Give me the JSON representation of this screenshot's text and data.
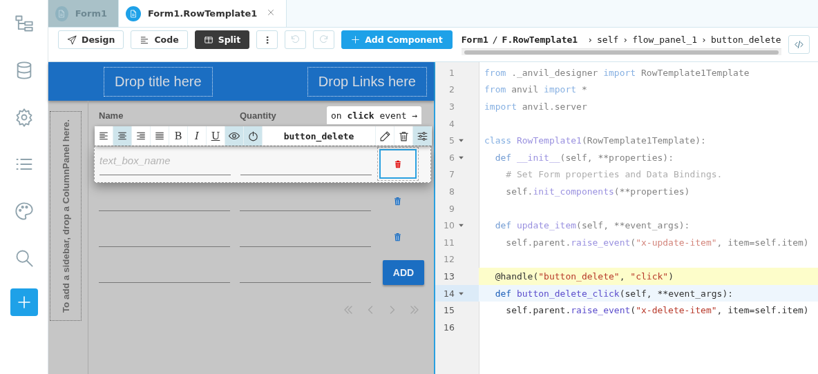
{
  "tabs": [
    {
      "label": "Form1",
      "selected": false,
      "closable": false
    },
    {
      "label": "Form1.RowTemplate1",
      "selected": true,
      "closable": true
    }
  ],
  "toolbar": {
    "modes": [
      {
        "kind": "design",
        "label": "Design",
        "selected": false
      },
      {
        "kind": "code",
        "label": "Code",
        "selected": false
      },
      {
        "kind": "split",
        "label": "Split",
        "selected": true
      }
    ],
    "history": [
      {
        "kind": "undo",
        "disabled": true
      },
      {
        "kind": "redo",
        "disabled": true
      }
    ],
    "add_button": "Add Component",
    "breadcrumb": {
      "form": "Form1",
      "separator": "/",
      "template": "F.RowTemplate1",
      "path": [
        {
          "sep": "›",
          "text": "self"
        },
        {
          "sep": "›",
          "text": "flow_panel_1"
        },
        {
          "sep": "›",
          "text": "button_delete"
        }
      ]
    }
  },
  "designer": {
    "title_slot": "Drop title here",
    "links_slot": "Drop Links here",
    "sidebar_slot": "To add a sidebar, drop a ColumnPanel here.",
    "headers": [
      "Name",
      "Quantity"
    ],
    "rows": [
      {
        "selected": true,
        "placeholder": "text_box_name"
      },
      {
        "selected": false
      },
      {
        "selected": false
      }
    ],
    "add_button": "ADD",
    "event_hint": "on **click** event →",
    "component_toolbar": {
      "align": [
        {
          "kind": "left",
          "selected": false
        },
        {
          "kind": "center",
          "selected": true
        },
        {
          "kind": "right",
          "selected": false
        },
        {
          "kind": "justify",
          "selected": false
        }
      ],
      "format": [
        {
          "kind": "bold",
          "label": "B",
          "selected": false
        },
        {
          "kind": "italic",
          "label": "I",
          "selected": false
        },
        {
          "kind": "underline",
          "label": "U",
          "selected": false
        }
      ],
      "toggles": [
        {
          "kind": "visible",
          "on": true
        },
        {
          "kind": "enabled",
          "on": true
        }
      ],
      "component_name": "button_delete",
      "actions": [
        {
          "kind": "edit",
          "selected": false
        },
        {
          "kind": "delete",
          "selected": false
        },
        {
          "kind": "properties",
          "selected": true
        }
      ]
    }
  },
  "code": {
    "lines": [
      {
        "number": "1",
        "fold": false,
        "faded": true,
        "tokens": [
          {
            "kind": "keyword",
            "text": "from"
          },
          {
            "kind": "plain",
            "text": " ._anvil_designer "
          },
          {
            "kind": "keyword",
            "text": "import"
          },
          {
            "kind": "plain",
            "text": " RowTemplate1Template"
          }
        ]
      },
      {
        "number": "2",
        "fold": false,
        "faded": true,
        "tokens": [
          {
            "kind": "keyword",
            "text": "from"
          },
          {
            "kind": "plain",
            "text": " anvil "
          },
          {
            "kind": "keyword",
            "text": "import"
          },
          {
            "kind": "plain",
            "text": " *"
          }
        ]
      },
      {
        "number": "3",
        "fold": false,
        "faded": true,
        "tokens": [
          {
            "kind": "keyword",
            "text": "import"
          },
          {
            "kind": "plain",
            "text": " anvil.server"
          }
        ]
      },
      {
        "number": "4",
        "fold": false,
        "faded": true
      },
      {
        "number": "5",
        "fold": true,
        "faded": true,
        "tokens": [
          {
            "kind": "keyword",
            "text": "class"
          },
          {
            "kind": "name",
            "text": " RowTemplate1"
          },
          {
            "kind": "plain",
            "text": "(RowTemplate1Template):"
          }
        ]
      },
      {
        "number": "6",
        "fold": true,
        "faded": true,
        "tokens": [
          {
            "kind": "def",
            "text": "  def"
          },
          {
            "kind": "name",
            "text": " __init__"
          },
          {
            "kind": "plain",
            "text": "(self, **properties):"
          }
        ]
      },
      {
        "number": "7",
        "fold": false,
        "faded": true,
        "tokens": [
          {
            "kind": "comment",
            "text": "    # Set Form properties and Data Bindings."
          }
        ]
      },
      {
        "number": "8",
        "fold": false,
        "faded": true,
        "tokens": [
          {
            "kind": "plain",
            "text": "    self."
          },
          {
            "kind": "name",
            "text": "init_components"
          },
          {
            "kind": "plain",
            "text": "(**properties)"
          }
        ]
      },
      {
        "number": "9",
        "fold": false,
        "faded": true
      },
      {
        "number": "10",
        "fold": true,
        "faded": true,
        "tokens": [
          {
            "kind": "def",
            "text": "  def"
          },
          {
            "kind": "name",
            "text": " update_item"
          },
          {
            "kind": "plain",
            "text": "(self, **event_args):"
          }
        ]
      },
      {
        "number": "11",
        "fold": false,
        "faded": true,
        "tokens": [
          {
            "kind": "plain",
            "text": "    self.parent."
          },
          {
            "kind": "name",
            "text": "raise_event"
          },
          {
            "kind": "plain",
            "text": "("
          },
          {
            "kind": "string",
            "text": "\"x-update-item\""
          },
          {
            "kind": "plain",
            "text": ", item=self.item)"
          }
        ]
      },
      {
        "number": "12",
        "fold": false,
        "faded": true
      },
      {
        "number": "13",
        "fold": false,
        "faded": false,
        "marked": true,
        "tokens": [
          {
            "kind": "plain",
            "text": "  @handle("
          },
          {
            "kind": "string",
            "text": "\"button_delete\""
          },
          {
            "kind": "plain",
            "text": ", "
          },
          {
            "kind": "string",
            "text": "\"click\""
          },
          {
            "kind": "plain",
            "text": ")"
          }
        ]
      },
      {
        "number": "14",
        "fold": true,
        "faded": false,
        "current": true,
        "tokens": [
          {
            "kind": "def",
            "text": "  def"
          },
          {
            "kind": "name",
            "text": " button_delete_click"
          },
          {
            "kind": "plain",
            "text": "(self, **event_args):"
          }
        ]
      },
      {
        "number": "15",
        "fold": false,
        "faded": false,
        "tokens": [
          {
            "kind": "plain",
            "text": "    self.parent."
          },
          {
            "kind": "name",
            "text": "raise_event"
          },
          {
            "kind": "plain",
            "text": "("
          },
          {
            "kind": "string",
            "text": "\"x-delete-item\""
          },
          {
            "kind": "plain",
            "text": ", item=self.item)"
          }
        ]
      },
      {
        "number": "16",
        "fold": false,
        "faded": false
      }
    ]
  }
}
